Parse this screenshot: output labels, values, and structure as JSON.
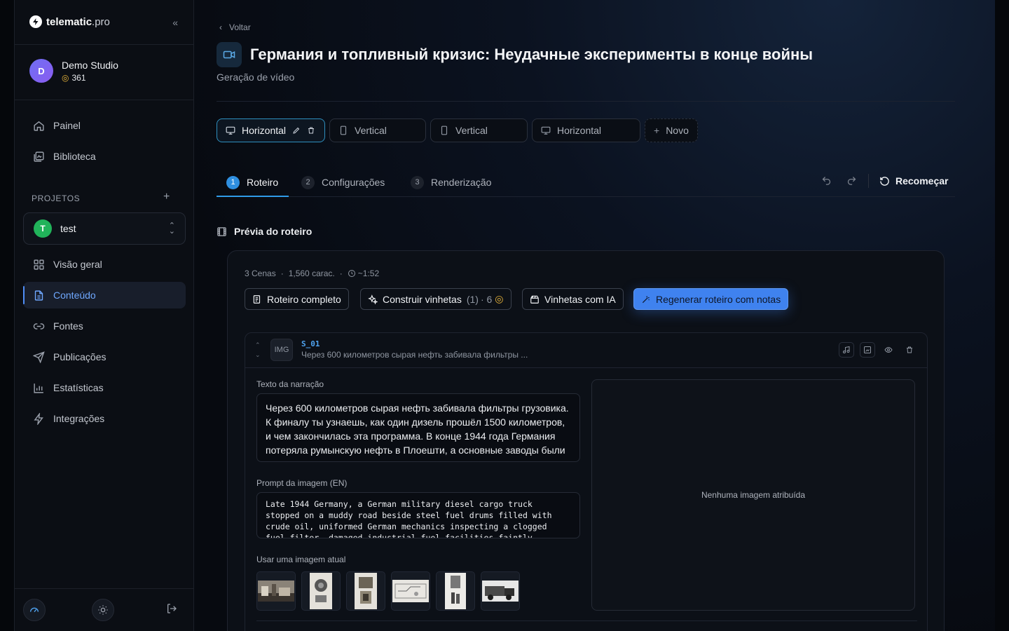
{
  "brand": {
    "name": "telematic",
    "suffix": ".pro"
  },
  "account": {
    "initial": "D",
    "name": "Demo Studio",
    "credits": "361"
  },
  "nav_top": [
    {
      "label": "Painel",
      "icon": "home-icon"
    },
    {
      "label": "Biblioteca",
      "icon": "library-icon"
    }
  ],
  "projects": {
    "label": "PROJETOS",
    "current_initial": "T",
    "current": "test"
  },
  "nav_project": [
    {
      "label": "Visão geral",
      "icon": "grid-icon"
    },
    {
      "label": "Conteúdo",
      "icon": "document-icon",
      "active": true
    },
    {
      "label": "Fontes",
      "icon": "link-icon"
    },
    {
      "label": "Publicações",
      "icon": "send-icon"
    },
    {
      "label": "Estatísticas",
      "icon": "bar-chart-icon"
    },
    {
      "label": "Integrações",
      "icon": "bolt-icon"
    }
  ],
  "header": {
    "back": "Voltar",
    "title": "Германия и топливный кризис: Неудачные эксперименты в конце войны",
    "subtitle": "Geração de vídeo"
  },
  "formats": [
    {
      "label": "Horizontal",
      "icon": "monitor-icon",
      "active": true
    },
    {
      "label": "Vertical",
      "icon": "phone-icon"
    },
    {
      "label": "Vertical",
      "icon": "phone-icon"
    },
    {
      "label": "Horizontal",
      "icon": "monitor-icon"
    },
    {
      "label": "Novo",
      "icon": "plus-icon"
    }
  ],
  "steps": [
    {
      "num": "1",
      "label": "Roteiro",
      "active": true
    },
    {
      "num": "2",
      "label": "Configurações"
    },
    {
      "num": "3",
      "label": "Renderização"
    }
  ],
  "restart_label": "Recomeçar",
  "preview": {
    "heading": "Prévia do roteiro",
    "scenes": "3 Cenas",
    "chars": "1,560 carac.",
    "duration": "~1:52",
    "buttons": {
      "full": "Roteiro completo",
      "build": "Construir vinhetas",
      "build_count": "(1)",
      "build_cost": "· 6",
      "ai": "Vinhetas com IA",
      "regen": "Regenerar roteiro com notas"
    }
  },
  "scene": {
    "tag": "IMG",
    "id": "S_01",
    "desc": "Через 600 километров сырая нефть забивала фильтры ...",
    "narration_label": "Texto da narração",
    "narration": "Через 600 километров сырая нефть забивала фильтры грузовика. К финалу ты узнаешь, как один дизель прошёл 1500 километров, и чем закончилась эта программа. В конце 1944 года Германия потеряла румынскую нефть в Плоешти, а основные заводы были по заводам синтетического горючего...",
    "prompt_label": "Prompt da imagem (EN)",
    "prompt": "Late 1944 Germany, a German military diesel cargo truck stopped on a muddy road beside steel fuel drums filled with crude oil, uniformed German mechanics inspecting a clogged fuel filter, damaged industrial fuel facilities faintly",
    "use_label": "Usar uma imagem atual",
    "no_image": "Nenhuma imagem atribuída"
  },
  "colors": {
    "accent": "#3f82ef",
    "active_tab": "#2f9be8",
    "coin": "#e8b43a",
    "project": "#21b35a"
  }
}
